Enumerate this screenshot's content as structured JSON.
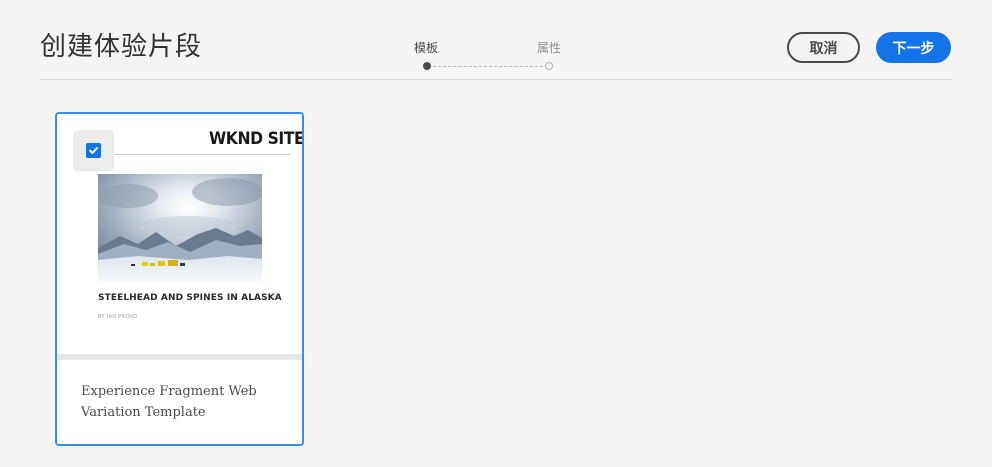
{
  "header": {
    "title": "创建体验片段",
    "steps": [
      {
        "label": "模板",
        "state": "active"
      },
      {
        "label": "属性",
        "state": "inactive"
      }
    ],
    "cancel_label": "取消",
    "next_label": "下一步"
  },
  "colors": {
    "accent": "#1473e6",
    "selected_border": "#378ef0",
    "background": "#f4f4f4"
  },
  "template_card": {
    "selected": true,
    "checkbox_icon": "checkmark-icon",
    "preview": {
      "site_logo": "WKND SITE",
      "article_title": "STEELHEAD AND SPINES IN ALASKA",
      "byline": "BY IAN PROVO"
    },
    "title": "Experience Fragment Web Variation Template"
  }
}
